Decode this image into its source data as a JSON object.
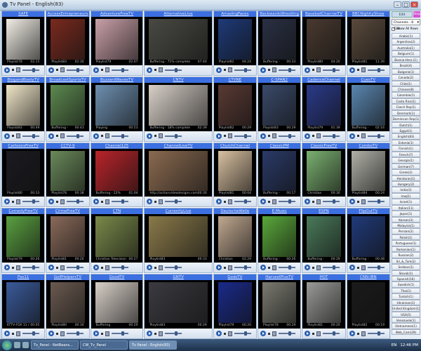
{
  "window": {
    "title": "Tv Panel - English(83)"
  },
  "sidebar": {
    "edit_label": "Edit Channels",
    "stop_label": "Stop",
    "layout_select": "Channels - 8 Cols",
    "show_all_label": "Show All Rows",
    "categories": [
      "Arabic(1)",
      "Argentina(2)",
      "Australia(1)",
      "Belgium(1)",
      "Bosnia-Herz.(1)",
      "Brazil(4)",
      "Bulgaria(1)",
      "Canada(2)",
      "Chile(1)",
      "Chinese(8)",
      "Colombia(1)",
      "Costa Rica(1)",
      "Czech Rep(1)",
      "Denmark(1)",
      "Dominican Rep(1)",
      "Dutch(1)",
      "Egypt(1)",
      "English(83)",
      "Estonia(1)",
      "Finnish(1)",
      "French(7)",
      "Georgia(1)",
      "German(7)",
      "Greek(2)",
      "Honduras(1)",
      "Hungary(2)",
      "India(3)",
      "Iraq(1)",
      "Israel(1)",
      "Italian(11)",
      "Japan(1)",
      "Korean(3)",
      "Malaysia(1)",
      "Persian(2)",
      "Polish(1)",
      "Portuguese(1)",
      "Romanian(1)",
      "Russian(2)",
      "Sri_&_Turk(2)",
      "Serbian(1)",
      "Slovak(1)",
      "Spanish(16)",
      "Swedish(1)",
      "Thai(1)",
      "Turkish(1)",
      "Ukrainian(1)",
      "United Kingdom(1)",
      "USA(5)",
      "Venezuela(1)",
      "Vietnamese(1)",
      "Web_Cam(29)"
    ]
  },
  "channels": [
    {
      "title": "SAFE",
      "status": "Playlist78",
      "time": "02:15",
      "color": "#f2eee6"
    },
    {
      "title": "AccessEntrepreneurs",
      "status": "Playlist83",
      "time": "02:30",
      "color": "#7a2a1e"
    },
    {
      "title": "AdventureFreeTV",
      "status": "Playlist79",
      "time": "02:07",
      "color": "#c9a0a8"
    },
    {
      "title": "AlternativeLive",
      "status": "Buffering - 71% complete",
      "time": "07:40",
      "color": "#4a4a44"
    },
    {
      "title": "AmazingFaces",
      "status": "Playlist82",
      "time": "04:24",
      "color": "#1e3a78"
    },
    {
      "title": "BackwardsWrestling",
      "status": "Buffering - 29% complete",
      "time": "00:33",
      "color": "#2a3044"
    },
    {
      "title": "BaseballChannelTV",
      "status": "Playlist80",
      "time": "04:20",
      "color": "#4a3a30"
    },
    {
      "title": "BBCNightlyShow",
      "status": "Playlist81",
      "time": "11:39",
      "color": "#5a4a3c"
    },
    {
      "title": "BlogandBootyTV",
      "status": "Playlist83",
      "time": "00:49",
      "color": "#f0e6c8"
    },
    {
      "title": "BroadcastSportsTV",
      "status": "Buffering - 10% complete",
      "time": "00:43",
      "color": "#5d8a50"
    },
    {
      "title": "BuzzardWavesTV",
      "status": "Playing 'www.illumination.tv'",
      "time": "00:53",
      "color": "#6d8fb0"
    },
    {
      "title": "CNTV",
      "status": "Buffering - 18% complete",
      "time": "02:39",
      "color": "#d8d0c8"
    },
    {
      "title": "CTVNE",
      "status": "Playlist82",
      "time": "00:29",
      "color": "#5a3a34"
    },
    {
      "title": "C-SPAN2",
      "status": "Playlist83",
      "time": "00:29",
      "color": "#3a4a6a"
    },
    {
      "title": "CadenceChannel",
      "status": "Playlist79",
      "time": "01:39",
      "color": "#2a3a8a"
    },
    {
      "title": "CuesTV",
      "status": "Buffering - 46% complete",
      "time": "02:16",
      "color": "#5a86b0"
    },
    {
      "title": "CartoonsFreeTV",
      "status": "Playlist80",
      "time": "00:33",
      "color": "#1a1a20"
    },
    {
      "title": "CCTV-9",
      "status": "Playlist78",
      "time": "00:38",
      "color": "#6a8a5a"
    },
    {
      "title": "Channel125",
      "status": "Buffering - 22% complete",
      "time": "01:04",
      "color": "#b8242a"
    },
    {
      "title": "ChannelLiveTV",
      "status": "http://actionvideodesigns.com",
      "time": "00:30",
      "color": "#8a6a50"
    },
    {
      "title": "ChurchChannel",
      "status": "Playlist81",
      "time": "00:04",
      "color": "#d8c0a0"
    },
    {
      "title": "ClassicPM",
      "status": "Buffering - 17% complete",
      "time": "00:17",
      "color": "#2a3a68"
    },
    {
      "title": "ClassicFreeTV",
      "status": "Christian Television Network",
      "time": "00:30",
      "color": "#7ab070"
    },
    {
      "title": "ComboTV",
      "status": "Playlist84",
      "time": "00:24",
      "color": "#b0b0a8"
    },
    {
      "title": "ComedyFreeTV",
      "status": "Playlist79",
      "time": "00:26",
      "color": "#5aa040"
    },
    {
      "title": "CrimeFreeTV",
      "status": "Playlist81",
      "time": "00:26",
      "color": "#8a6a5a"
    },
    {
      "title": "CTN",
      "status": "Christian Television Network",
      "time": "00:27",
      "color": "#7a8a4a"
    },
    {
      "title": "CurrentlyLive",
      "status": "Playlist83",
      "time": "00:33",
      "color": "#8a7a4a"
    },
    {
      "title": "DeutscheWelle",
      "status": "Christian Television Network",
      "time": "02:29",
      "color": "#c0a890"
    },
    {
      "title": "E-Music",
      "status": "Buffering - 21% complete",
      "time": "00:26",
      "color": "#5aa83a"
    },
    {
      "title": "ESPN",
      "status": "Buffering - 20% complete",
      "time": "00:29",
      "color": "#4a7a5a"
    },
    {
      "title": "FlipOutTV",
      "status": "Buffering - 10% complete",
      "time": "00:48",
      "color": "#203a7a"
    },
    {
      "title": "Fox11",
      "status": "KTTV-FOX 11 / 4:30 HLS/4",
      "time": "00:05",
      "color": "#3a5a9a"
    },
    {
      "title": "GolfHelpersTV",
      "status": "Playlist80",
      "time": "00:30",
      "color": "#6a5a50"
    },
    {
      "title": "GoodTV",
      "status": "Buffering",
      "time": "00:29",
      "color": "#d8d0c8"
    },
    {
      "title": "GNTV",
      "status": "Playlist83",
      "time": "00:29",
      "color": "#3a3a40"
    },
    {
      "title": "GodsTV",
      "status": "Playlist79",
      "time": "00:26",
      "color": "#1a2a8a"
    },
    {
      "title": "HarvestPlusTV",
      "status": "Playlist78",
      "time": "00:29",
      "color": "#7a7a70"
    },
    {
      "title": "HOT",
      "status": "Playlist81",
      "time": "00:20",
      "color": "#9a9a98"
    },
    {
      "title": "CNN-IBN",
      "status": "Playlist82",
      "time": "00:19",
      "color": "#1a1a1a"
    }
  ],
  "taskbar": {
    "items": [
      "Tv_Panel - NetBeans...",
      "CW_Tv_Panel",
      "Tv Panel - English(83)"
    ],
    "active": 2,
    "language": "EN",
    "clock": "12:46 PM"
  }
}
